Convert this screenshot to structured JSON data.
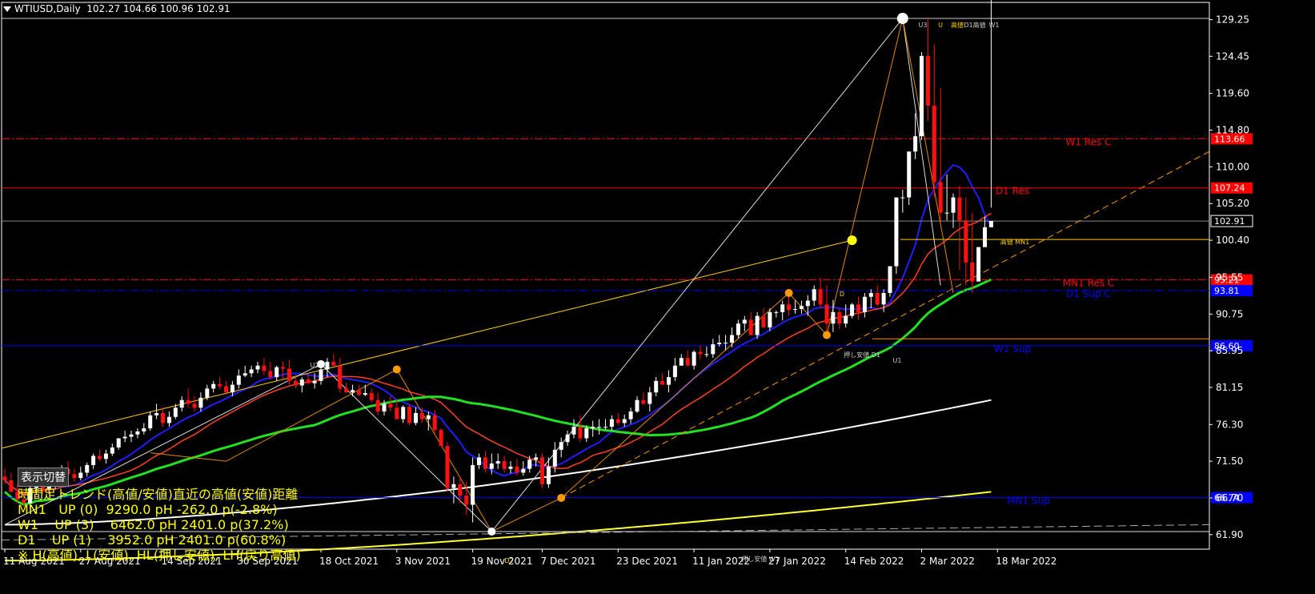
{
  "header": {
    "symbol_tf": "WTIUSD,Daily",
    "ohlc": "102.27 104.66 100.96 102.91"
  },
  "panel": {
    "toggle_label": "表示切替",
    "title": "時間足トレンド(高値/安値)直近の高値(安値)距離",
    "rows": [
      "MN1   UP (0)  9290.0 pH -262.0 p(-2.8%)",
      "W1    UP (3)    6462.0 pH 2401.0 p(37.2%)",
      "D1    UP (1)    3952.0 pH 2401.0 p(60.8%)",
      "※ H(高値), L(安値), HL(押し安値), LH(戻り高値)"
    ]
  },
  "chart_data": {
    "type": "candlestick",
    "title": "",
    "price_axis": {
      "ticks": [
        129.25,
        124.45,
        119.6,
        114.8,
        110.0,
        105.2,
        100.4,
        95.55,
        90.75,
        85.95,
        81.15,
        76.3,
        71.5,
        66.7,
        61.9
      ],
      "range": [
        60.0,
        131.5
      ]
    },
    "time_axis": {
      "labels": [
        "11 Aug 2021",
        "27 Aug 2021",
        "14 Sep 2021",
        "30 Sep 2021",
        "18 Oct 2021",
        "3 Nov 2021",
        "19 Nov 2021",
        "7 Dec 2021",
        "23 Dec 2021",
        "11 Jan 2022",
        "27 Jan 2022",
        "14 Feb 2022",
        "2 Mar 2022",
        "18 Mar 2022"
      ]
    },
    "current_price": "102.91",
    "levels": [
      {
        "label": "W1 Res C",
        "price": 113.66,
        "tag": "113.66",
        "color": "#ff0000",
        "style": "dashdot"
      },
      {
        "label": "D1 Res",
        "price": 107.24,
        "tag": "107.24",
        "color": "#ff0000",
        "style": "solid"
      },
      {
        "label": "MN1 Res C",
        "price": 95.21,
        "tag": "95.21",
        "color": "#ff0000",
        "style": "dashdot"
      },
      {
        "label": "D1 Sup C",
        "price": 93.81,
        "tag": "93.81",
        "color": "#0000ff",
        "style": "dashdot"
      },
      {
        "label": "W1 Sup",
        "price": 86.6,
        "tag": "86.60",
        "color": "#0000ff",
        "style": "solid"
      },
      {
        "label": "MN1 Sup",
        "price": 66.74,
        "tag": "66.74",
        "color": "#0000ff",
        "style": "solid"
      }
    ],
    "annotations": [
      "U3",
      "U",
      "高値",
      "D1高値",
      "W1",
      "U2",
      "D",
      "D2",
      "U1",
      "高値 MN1",
      "押し安値 D1",
      "押し安値 W1"
    ],
    "series": [
      {
        "name": "",
        "open": [
          69.5,
          69,
          67.5,
          66.5,
          66,
          68,
          69,
          67.8,
          68.2,
          68.8,
          70.5,
          69.8,
          69.3,
          70,
          71,
          72.2,
          71.8,
          72.5,
          73.3,
          74.5,
          74.7,
          75,
          75.4,
          75.8,
          77.5,
          77.8,
          76.5,
          77.3,
          78.5,
          79.5,
          79,
          78.5,
          79.8,
          81,
          81.6,
          81.3,
          80.5,
          81.5,
          82.7,
          83,
          83.5,
          84,
          83.3,
          82.5,
          83.8,
          83.6,
          82,
          81.4,
          82.2,
          81.7,
          82,
          83.5,
          84.5,
          84,
          81,
          80.5,
          80.8,
          80.2,
          80.4,
          79.5,
          78,
          79,
          78.5,
          77,
          78.6,
          76.5,
          77.8,
          77,
          77.5,
          75.6,
          73.5,
          68,
          68.5,
          67,
          65.8,
          71,
          72,
          70.5,
          71.2,
          71.5,
          70.5,
          70.8,
          70,
          70.5,
          71.7,
          72,
          68.5,
          70.8,
          73,
          74,
          75,
          76,
          74.5,
          75.8,
          76,
          76,
          76,
          77,
          76.5,
          77,
          78,
          79.5,
          79,
          80.5,
          82,
          81.5,
          82.5,
          84,
          85,
          84,
          85.8,
          85.5,
          85.5,
          86.8,
          87,
          87,
          88,
          89.5,
          90,
          88,
          90.5,
          89,
          91,
          91,
          92,
          91.3,
          91.4,
          91.8,
          92.5,
          94,
          92,
          89.5,
          91,
          89.5,
          90.5,
          92,
          91,
          93,
          93.5,
          92,
          93.5,
          97,
          106,
          106,
          112,
          114,
          124.5,
          118,
          108,
          104,
          104,
          106,
          103,
          97.5,
          95,
          99.5,
          102.1
        ],
        "high": [
          70.5,
          70,
          68.5,
          67.5,
          68.5,
          69.5,
          70,
          68.8,
          69.5,
          71,
          71.5,
          70.5,
          70.8,
          71.3,
          72.5,
          73,
          73,
          73.8,
          74.5,
          75.5,
          75.5,
          75.8,
          76.5,
          78,
          79,
          78.5,
          78,
          79,
          80,
          81,
          80,
          80.5,
          81.5,
          82,
          82.5,
          82,
          82,
          83.5,
          84,
          84,
          84.5,
          85,
          84.5,
          84,
          84.5,
          84.7,
          82.8,
          82.5,
          83,
          83,
          84,
          85,
          85.5,
          85,
          81.8,
          81.5,
          81.5,
          81.5,
          81,
          80.5,
          79.5,
          80,
          79.5,
          78.8,
          79,
          78.6,
          78.5,
          78,
          78.2,
          75.8,
          74,
          69.5,
          69.5,
          68.8,
          72,
          72.5,
          72.8,
          72.5,
          72.5,
          72.2,
          71.5,
          71.8,
          71.5,
          72.2,
          72.5,
          72.5,
          72,
          74,
          74.6,
          75.5,
          77,
          77.5,
          76.2,
          76.8,
          77,
          77,
          77.5,
          77.8,
          77.6,
          78.5,
          80,
          80.5,
          81.2,
          82.5,
          83,
          83.4,
          85,
          85.5,
          86,
          86,
          86.6,
          86.5,
          87.5,
          88,
          88,
          89,
          90,
          90.5,
          91,
          91,
          91.5,
          91.5,
          91.2,
          92.5,
          93,
          92.5,
          92.5,
          93.2,
          94.5,
          95.5,
          94.5,
          92.6,
          91.5,
          92,
          92.2,
          93,
          93.5,
          94,
          94.5,
          94,
          96,
          100.5,
          107,
          111,
          117,
          125,
          129.4,
          126,
          120.3,
          109,
          106.5,
          107.5,
          106,
          104,
          99.5,
          103.5,
          104.66
        ],
        "low": [
          68.5,
          67.4,
          66,
          65.5,
          65.5,
          67.2,
          67.2,
          67.2,
          67.8,
          68.5,
          69.5,
          68.8,
          69,
          69.5,
          70.5,
          71.5,
          71.2,
          72.2,
          73,
          74,
          74,
          74.5,
          75,
          75.5,
          77,
          76,
          76,
          77,
          78,
          78.5,
          78,
          78,
          79.5,
          80.5,
          80.9,
          80.2,
          80,
          81,
          82.5,
          82.5,
          83,
          82.8,
          82.2,
          82,
          82.2,
          81.5,
          81,
          80.5,
          81.5,
          81,
          81.5,
          82.5,
          84,
          80.5,
          80.5,
          80,
          80,
          80,
          79.2,
          77.5,
          77.5,
          78,
          77,
          76.5,
          76.2,
          76.2,
          76.5,
          75.5,
          75,
          73.5,
          67.5,
          66,
          66,
          64.5,
          63.5,
          70.5,
          70,
          69.8,
          70.5,
          70,
          69.9,
          69.6,
          69.6,
          70,
          70.8,
          68,
          68,
          70,
          72,
          73.5,
          74.5,
          74,
          74,
          74.7,
          75,
          75.6,
          75.5,
          76.2,
          76,
          76.4,
          77.8,
          78.8,
          78,
          80,
          81.5,
          80.5,
          82,
          84,
          84,
          83.5,
          84.8,
          85.1,
          85,
          86.5,
          86,
          86.4,
          87.6,
          88.5,
          88,
          87.5,
          89.2,
          88.5,
          90.3,
          89.9,
          90.5,
          90.8,
          90.8,
          90.5,
          91.8,
          91.5,
          88.5,
          88.4,
          88.8,
          89,
          90.2,
          90,
          90.3,
          91.5,
          91.8,
          91,
          93,
          96,
          104,
          105,
          111,
          113.5,
          116,
          106,
          103,
          103,
          102,
          96.5,
          94.5,
          93.5,
          97,
          100.96
        ],
        "close": [
          69,
          67.5,
          66.5,
          66,
          68,
          69,
          67.8,
          68.2,
          68.8,
          70.5,
          69.8,
          69.3,
          70,
          71,
          72.2,
          71.8,
          72.5,
          73.3,
          74.5,
          74.7,
          75,
          75.4,
          75.8,
          77.5,
          77.8,
          76.5,
          77.3,
          78.5,
          79.5,
          79,
          78.5,
          79.8,
          81,
          81.6,
          81.3,
          80.5,
          81.5,
          82.7,
          83,
          83.5,
          84,
          83.3,
          82.5,
          83.8,
          83.6,
          82,
          81.4,
          82.2,
          81.7,
          82,
          83.5,
          84.5,
          84,
          81,
          80.5,
          80.8,
          80.2,
          80.4,
          79.5,
          78,
          79,
          78.5,
          77,
          78.6,
          76.5,
          77.8,
          77,
          77.5,
          75.6,
          73.5,
          68,
          68.5,
          67,
          65.8,
          71,
          72,
          70.5,
          71.2,
          71.5,
          70.5,
          70.8,
          70,
          70.5,
          71.7,
          72,
          68.5,
          70.8,
          73,
          74,
          75,
          76,
          74.5,
          75.8,
          76,
          76,
          76,
          77,
          76.5,
          77,
          78,
          79.5,
          79,
          80.5,
          82,
          81.5,
          82.5,
          84,
          85,
          84,
          85.8,
          85.5,
          85.5,
          86.8,
          87,
          87,
          88,
          89.5,
          90,
          88,
          90.5,
          89,
          91,
          91,
          92,
          91.3,
          91.4,
          91.8,
          92.5,
          94,
          92,
          89.5,
          91,
          89.5,
          90.5,
          92,
          91,
          93,
          93.5,
          92,
          93.5,
          97,
          106,
          106,
          112,
          114,
          124.5,
          118,
          108,
          104,
          104,
          106,
          103,
          97.5,
          95,
          99.5,
          102.1,
          102.91
        ]
      }
    ]
  }
}
